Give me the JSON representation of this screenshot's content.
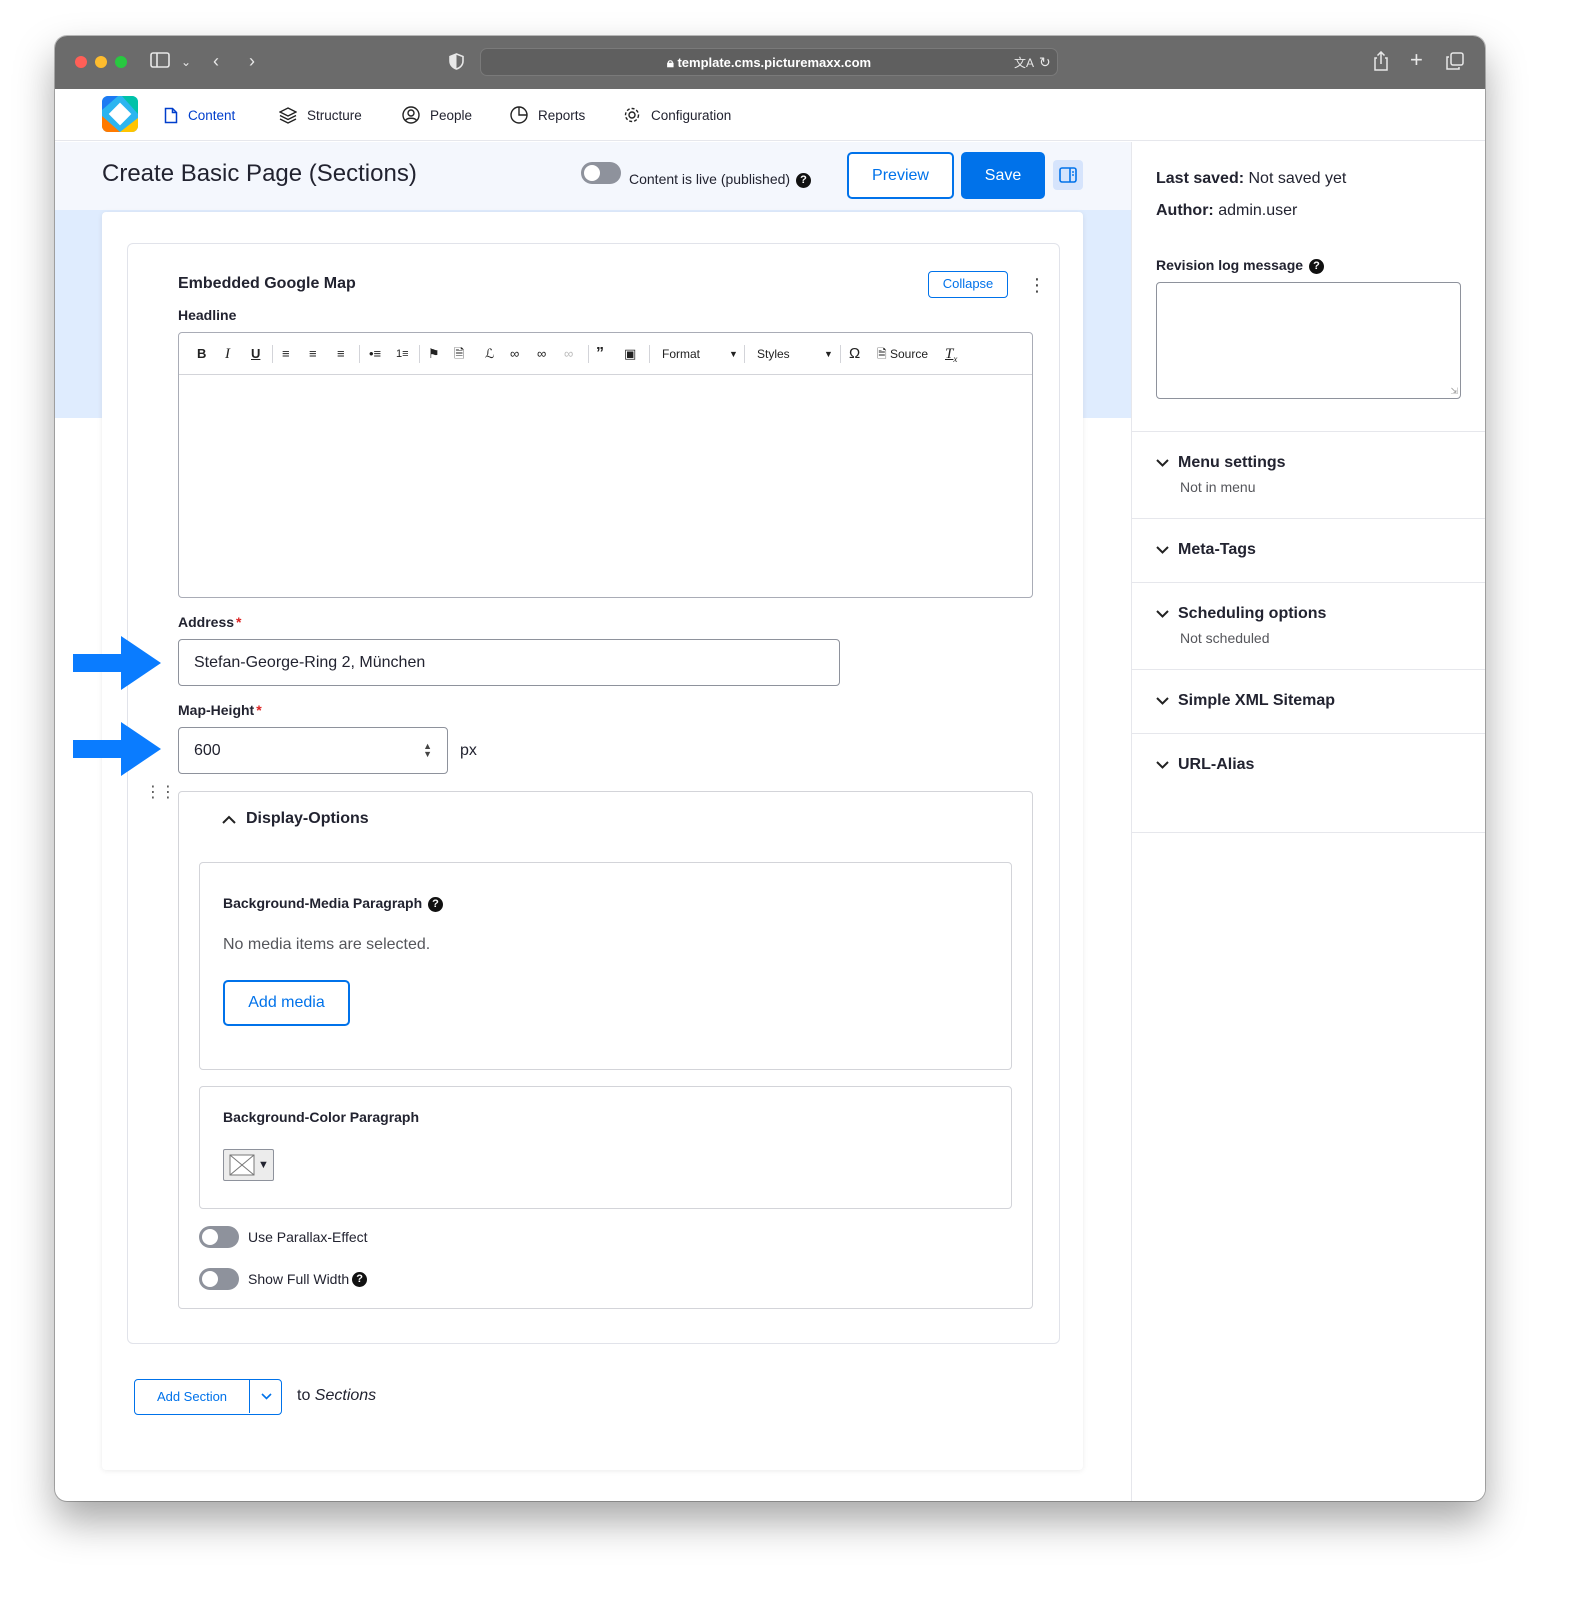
{
  "browser": {
    "url": "template.cms.picturemaxx.com"
  },
  "nav": {
    "items": [
      {
        "label": "Content",
        "icon": "document-icon",
        "active": true
      },
      {
        "label": "Structure",
        "icon": "layers-icon"
      },
      {
        "label": "People",
        "icon": "user-circle-icon"
      },
      {
        "label": "Reports",
        "icon": "pie-chart-icon"
      },
      {
        "label": "Configuration",
        "icon": "gear-icon"
      }
    ]
  },
  "header": {
    "title": "Create Basic Page (Sections)",
    "live_label": "Content is live (published)",
    "preview_label": "Preview",
    "save_label": "Save"
  },
  "section": {
    "title": "Embedded Google Map",
    "collapse_label": "Collapse",
    "headline_label": "Headline",
    "toolbar": {
      "format_label": "Format",
      "styles_label": "Styles",
      "source_label": "Source"
    },
    "address_label": "Address",
    "address_value": "Stefan-George-Ring 2, München",
    "map_height_label": "Map-Height",
    "map_height_value": "600",
    "map_height_unit": "px"
  },
  "display_options": {
    "title": "Display-Options",
    "bg_media_label": "Background-Media Paragraph",
    "bg_media_empty": "No media items are selected.",
    "add_media_label": "Add media",
    "bg_color_label": "Background-Color Paragraph",
    "parallax_label": "Use Parallax-Effect",
    "full_width_label": "Show Full Width"
  },
  "footer": {
    "add_section_label": "Add Section",
    "to_label": "to",
    "sections_label": "Sections"
  },
  "sidebar": {
    "last_saved_label": "Last saved:",
    "last_saved_value": "Not saved yet",
    "author_label": "Author:",
    "author_value": "admin.user",
    "revision_label": "Revision log message",
    "accordions": [
      {
        "title": "Menu settings",
        "subtitle": "Not in menu"
      },
      {
        "title": "Meta-Tags"
      },
      {
        "title": "Scheduling options",
        "subtitle": "Not scheduled"
      },
      {
        "title": "Simple XML Sitemap"
      },
      {
        "title": "URL-Alias"
      }
    ]
  },
  "colors": {
    "accent": "#0072ea",
    "required": "#dc2323",
    "hero": "#dfecfe",
    "annotation_arrow": "#0a7cff"
  }
}
